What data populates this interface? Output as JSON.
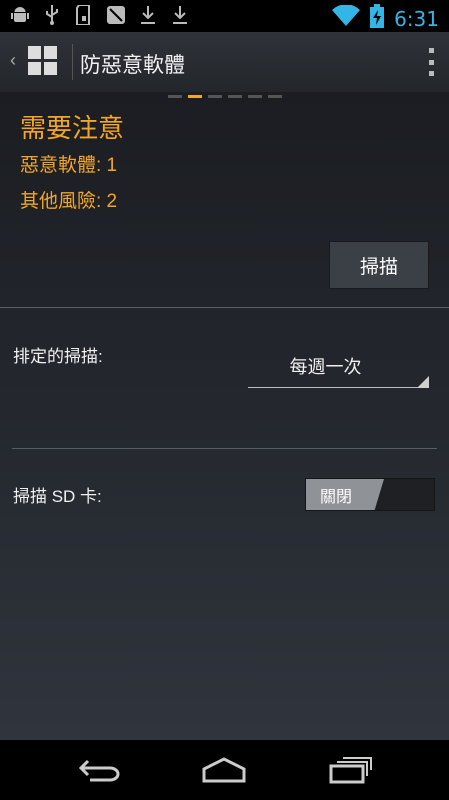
{
  "status_bar": {
    "time": "6:31",
    "left_icons": [
      "android-debug-icon",
      "usb-icon",
      "sd-card-icon",
      "no-sim-icon",
      "download-icon",
      "download-icon"
    ],
    "right_icons": [
      "wifi-icon",
      "battery-charging-icon"
    ],
    "accent": "#33b5e5"
  },
  "action_bar": {
    "title": "防惡意軟體",
    "app_icon": "grid-logo-icon"
  },
  "pager": {
    "pages": 6,
    "active_index": 1
  },
  "status": {
    "heading": "需要注意",
    "malware_label": "惡意軟體: 1",
    "other_risks_label": "其他風險: 2",
    "warning_color": "#f5a623"
  },
  "scan_button": {
    "label": "掃描"
  },
  "scheduled_scan": {
    "label": "排定的掃描:",
    "value": "每週一次"
  },
  "scan_sd": {
    "label": "掃描 SD 卡:",
    "toggle_label": "關閉",
    "enabled": false
  },
  "nav_bar": {
    "buttons": [
      "back-icon",
      "home-icon",
      "recent-apps-icon"
    ]
  }
}
